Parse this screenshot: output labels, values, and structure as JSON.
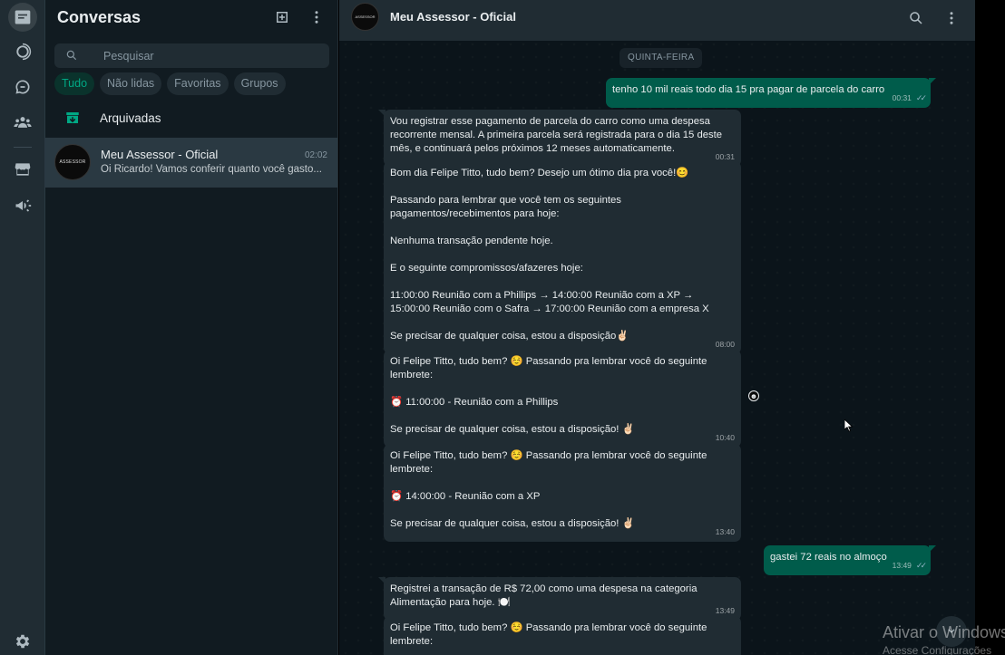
{
  "rail": {
    "icons": [
      "chats-icon",
      "status-icon",
      "channels-icon",
      "communities-icon",
      "business-tools-icon",
      "broadcast-icon",
      "settings-icon"
    ]
  },
  "sidebar": {
    "title": "Conversas",
    "search": {
      "placeholder": "Pesquisar",
      "value": ""
    },
    "filters": [
      "Tudo",
      "Não lidas",
      "Favoritas",
      "Grupos"
    ],
    "active_filter": "Tudo",
    "archived_label": "Arquivadas",
    "chats": [
      {
        "name": "Meu Assessor - Oficial",
        "time": "02:02",
        "preview": "Oi Ricardo! Vamos conferir quanto você gasto...",
        "avatar_text": "ASSESSOR"
      }
    ]
  },
  "conversation": {
    "name": "Meu Assessor - Oficial",
    "avatar_text": "ASSESSOR",
    "day_label": "QUINTA-FEIRA",
    "messages": [
      {
        "dir": "out",
        "text": "tenho 10 mil reais todo dia 15 pra pagar de parcela do carro",
        "time": "00:31",
        "read": true
      },
      {
        "dir": "in",
        "text": "Vou registrar esse pagamento de parcela do carro como uma despesa recorrente mensal. A primeira parcela será registrada para o dia 15 deste mês, e continuará pelos próximos 12 meses automaticamente.",
        "time": "00:31"
      },
      {
        "dir": "in",
        "text": "Bom dia Felipe Titto, tudo bem? Desejo um ótimo dia pra você!😊\n\nPassando para lembrar que você tem os seguintes pagamentos/recebimentos para hoje:\n\nNenhuma transação pendente hoje.\n\nE o seguinte compromissos/afazeres hoje:\n\n11:00:00 Reunião com a Phillips → 14:00:00 Reunião com a XP → 15:00:00 Reunião com o Safra → 17:00:00 Reunião com a empresa X\n\nSe precisar de qualquer coisa, estou a disposição✌🏻",
        "time": "08:00"
      },
      {
        "dir": "in",
        "text": "Oi Felipe Titto, tudo bem? ☺️ Passando pra lembrar você do seguinte lembrete:\n\n⏰ 11:00:00 - Reunião com a Phillips\n\nSe precisar de qualquer coisa, estou a disposição! ✌🏻",
        "time": "10:40"
      },
      {
        "dir": "in",
        "text": "Oi Felipe Titto, tudo bem? ☺️ Passando pra lembrar você do seguinte lembrete:\n\n⏰ 14:00:00 - Reunião com a XP\n\nSe precisar de qualquer coisa, estou a disposição! ✌🏻",
        "time": "13:40"
      },
      {
        "dir": "out",
        "text": "gastei 72 reais no almoço",
        "time": "13:49",
        "read": true
      },
      {
        "dir": "in",
        "text": "Registrei a transação de R$ 72,00 como uma despesa na categoria Alimentação para hoje. 🍽️",
        "time": "13:49"
      },
      {
        "dir": "in",
        "text": "Oi Felipe Titto, tudo bem? ☺️ Passando pra lembrar você do seguinte lembrete:",
        "time": ""
      }
    ]
  },
  "overlay": {
    "watermark_title": "Ativar o Windows",
    "watermark_sub": "Acesse Configurações"
  },
  "colors": {
    "accent": "#00a884",
    "outgoing_bubble": "#005c4b",
    "incoming_bubble": "#202c33",
    "panel_bg": "#111b21"
  }
}
